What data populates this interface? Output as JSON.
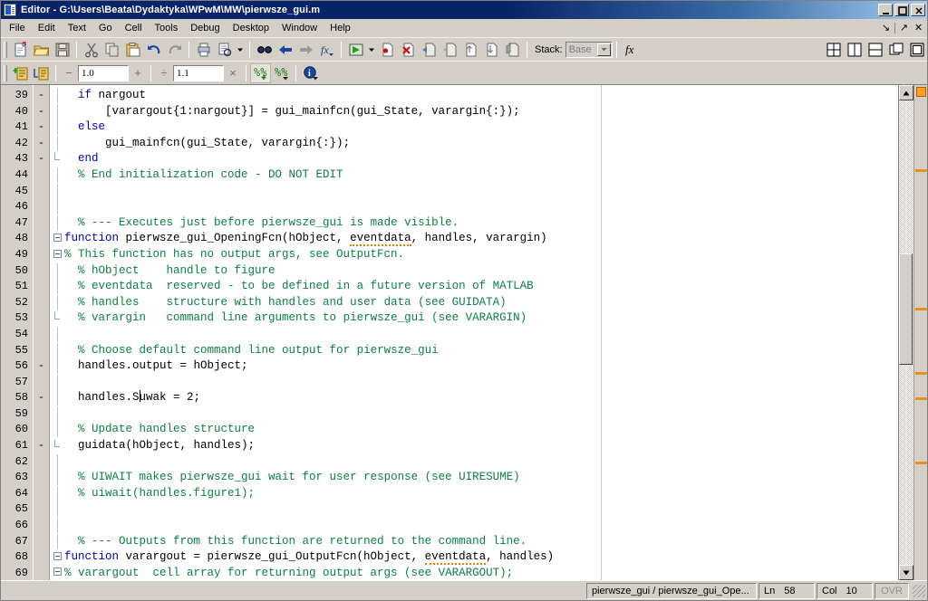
{
  "window": {
    "title": "Editor - G:\\Users\\Beata\\Dydaktyka\\WPwM\\MW\\pierwsze_gui.m",
    "icon": "editor-document-icon",
    "minimize_label": "_",
    "maximize_label": "☐",
    "close_label": "✕"
  },
  "menubar": {
    "items": [
      {
        "label": "File"
      },
      {
        "label": "Edit"
      },
      {
        "label": "Text"
      },
      {
        "label": "Go"
      },
      {
        "label": "Cell"
      },
      {
        "label": "Tools"
      },
      {
        "label": "Debug"
      },
      {
        "label": "Desktop"
      },
      {
        "label": "Window"
      },
      {
        "label": "Help"
      }
    ],
    "dock_label": "↘",
    "undock_label": "↗",
    "close_label": "✕"
  },
  "toolbar_main": {
    "buttons": [
      {
        "name": "new-file-icon",
        "title": "New"
      },
      {
        "name": "open-file-icon",
        "title": "Open"
      },
      {
        "name": "save-icon",
        "title": "Save"
      },
      {
        "name": "cut-icon",
        "title": "Cut"
      },
      {
        "name": "copy-icon",
        "title": "Copy"
      },
      {
        "name": "paste-icon",
        "title": "Paste"
      },
      {
        "name": "undo-icon",
        "title": "Undo"
      },
      {
        "name": "redo-icon",
        "title": "Redo"
      },
      {
        "name": "print-icon",
        "title": "Print"
      },
      {
        "name": "print-preview-icon",
        "title": "Print Preview"
      },
      {
        "name": "find-icon",
        "title": "Find"
      },
      {
        "name": "back-arrow-icon",
        "title": "Back"
      },
      {
        "name": "forward-arrow-icon",
        "title": "Forward"
      },
      {
        "name": "function-browser-icon",
        "title": "Function Browser"
      },
      {
        "name": "run-icon",
        "title": "Run"
      },
      {
        "name": "set-breakpoint-icon",
        "title": "Set/Clear Breakpoint"
      },
      {
        "name": "clear-breakpoints-icon",
        "title": "Clear All Breakpoints"
      },
      {
        "name": "step-icon",
        "title": "Step"
      },
      {
        "name": "step-in-icon",
        "title": "Step In"
      },
      {
        "name": "step-out-icon",
        "title": "Step Out"
      },
      {
        "name": "continue-icon",
        "title": "Continue"
      },
      {
        "name": "exit-debug-icon",
        "title": "Exit Debug Mode"
      }
    ],
    "stack_label": "Stack:",
    "stack_value": "Base",
    "fx_label": "fx",
    "layout_buttons": [
      {
        "name": "tile-four-icon"
      },
      {
        "name": "tile-vertical-icon"
      },
      {
        "name": "tile-horizontal-icon"
      },
      {
        "name": "cascade-icon"
      },
      {
        "name": "single-pane-icon"
      }
    ]
  },
  "toolbar_cell": {
    "buttons": [
      {
        "name": "insert-cell-icon",
        "title": "Insert Cell Divider"
      },
      {
        "name": "insert-cell-markup-icon",
        "title": "Insert Cell Markup"
      },
      {
        "name": "evaluate-cell-plus-icon",
        "title": "Evaluate Cell and Advance"
      },
      {
        "name": "evaluate-cell-icon",
        "title": "Evaluate Cell"
      },
      {
        "name": "cell-help-icon",
        "title": "Cell Mode Help"
      }
    ],
    "decrement_label": "−",
    "increment_label": "+",
    "divide_label": "÷",
    "multiply_label": "×",
    "value_add": "1.0",
    "value_multiply": "1.1"
  },
  "editor": {
    "caret_line": 58,
    "caret_col": 10,
    "lines": [
      {
        "num": 39,
        "mark": "-",
        "fold": "",
        "indent": 1,
        "tokens": [
          {
            "t": "kw",
            "v": "if"
          },
          {
            "t": "p",
            "v": " nargout"
          }
        ]
      },
      {
        "num": 40,
        "mark": "-",
        "fold": "",
        "indent": 1,
        "tokens": [
          {
            "t": "p",
            "v": "    [varargout{1:nargout}] = gui_mainfcn(gui_State, varargin{:});"
          }
        ]
      },
      {
        "num": 41,
        "mark": "-",
        "fold": "",
        "indent": 1,
        "tokens": [
          {
            "t": "kw",
            "v": "else"
          }
        ]
      },
      {
        "num": 42,
        "mark": "-",
        "fold": "",
        "indent": 1,
        "tokens": [
          {
            "t": "p",
            "v": "    gui_mainfcn(gui_State, varargin{:});"
          }
        ]
      },
      {
        "num": 43,
        "mark": "-",
        "fold": "end",
        "indent": 1,
        "tokens": [
          {
            "t": "kw",
            "v": "end"
          }
        ]
      },
      {
        "num": 44,
        "mark": "",
        "fold": "",
        "indent": 1,
        "tokens": [
          {
            "t": "cm",
            "v": "% End initialization code - DO NOT EDIT"
          }
        ]
      },
      {
        "num": 45,
        "mark": "",
        "fold": "",
        "indent": 1,
        "tokens": []
      },
      {
        "num": 46,
        "mark": "",
        "fold": "",
        "indent": 1,
        "tokens": []
      },
      {
        "num": 47,
        "mark": "",
        "fold": "",
        "indent": 1,
        "tokens": [
          {
            "t": "cm",
            "v": "% --- Executes just before pierwsze_gui is made visible."
          }
        ]
      },
      {
        "num": 48,
        "mark": "",
        "fold": "box",
        "indent": 0,
        "tokens": [
          {
            "t": "kw",
            "v": "function"
          },
          {
            "t": "p",
            "v": " pierwsze_gui_OpeningFcn(hObject, "
          },
          {
            "t": "sq",
            "v": "eventdata"
          },
          {
            "t": "p",
            "v": ", handles, varargin)"
          }
        ]
      },
      {
        "num": 49,
        "mark": "",
        "fold": "box",
        "indent": 0,
        "tokens": [
          {
            "t": "cm",
            "v": "% This function has no output args, see OutputFcn."
          }
        ]
      },
      {
        "num": 50,
        "mark": "",
        "fold": "",
        "indent": 1,
        "tokens": [
          {
            "t": "cm",
            "v": "% hObject    handle to figure"
          }
        ]
      },
      {
        "num": 51,
        "mark": "",
        "fold": "",
        "indent": 1,
        "tokens": [
          {
            "t": "cm",
            "v": "% eventdata  reserved - to be defined in a future version of MATLAB"
          }
        ]
      },
      {
        "num": 52,
        "mark": "",
        "fold": "",
        "indent": 1,
        "tokens": [
          {
            "t": "cm",
            "v": "% handles    structure with handles and user data (see GUIDATA)"
          }
        ]
      },
      {
        "num": 53,
        "mark": "",
        "fold": "end",
        "indent": 1,
        "tokens": [
          {
            "t": "cm",
            "v": "% varargin   command line arguments to pierwsze_gui (see VARARGIN)"
          }
        ]
      },
      {
        "num": 54,
        "mark": "",
        "fold": "",
        "indent": 1,
        "tokens": []
      },
      {
        "num": 55,
        "mark": "",
        "fold": "",
        "indent": 1,
        "tokens": [
          {
            "t": "cm",
            "v": "% Choose default command line output for pierwsze_gui"
          }
        ]
      },
      {
        "num": 56,
        "mark": "-",
        "fold": "",
        "indent": 1,
        "tokens": [
          {
            "t": "p",
            "v": "handles.output = hObject;"
          }
        ]
      },
      {
        "num": 57,
        "mark": "",
        "fold": "",
        "indent": 1,
        "tokens": []
      },
      {
        "num": 58,
        "mark": "-",
        "fold": "",
        "indent": 1,
        "tokens": [
          {
            "t": "p",
            "v": "handles.S"
          },
          {
            "t": "caret",
            "v": ""
          },
          {
            "t": "p",
            "v": "uwak = 2;"
          }
        ]
      },
      {
        "num": 59,
        "mark": "",
        "fold": "",
        "indent": 1,
        "tokens": []
      },
      {
        "num": 60,
        "mark": "",
        "fold": "",
        "indent": 1,
        "tokens": [
          {
            "t": "cm",
            "v": "% Update handles structure"
          }
        ]
      },
      {
        "num": 61,
        "mark": "-",
        "fold": "end",
        "indent": 1,
        "tokens": [
          {
            "t": "p",
            "v": "guidata(hObject, handles);"
          }
        ]
      },
      {
        "num": 62,
        "mark": "",
        "fold": "",
        "indent": 1,
        "tokens": []
      },
      {
        "num": 63,
        "mark": "",
        "fold": "",
        "indent": 1,
        "tokens": [
          {
            "t": "cm",
            "v": "% UIWAIT makes pierwsze_gui wait for user response (see UIRESUME)"
          }
        ]
      },
      {
        "num": 64,
        "mark": "",
        "fold": "",
        "indent": 1,
        "tokens": [
          {
            "t": "cm",
            "v": "% uiwait(handles.figure1);"
          }
        ]
      },
      {
        "num": 65,
        "mark": "",
        "fold": "",
        "indent": 1,
        "tokens": []
      },
      {
        "num": 66,
        "mark": "",
        "fold": "",
        "indent": 1,
        "tokens": []
      },
      {
        "num": 67,
        "mark": "",
        "fold": "",
        "indent": 1,
        "tokens": [
          {
            "t": "cm",
            "v": "% --- Outputs from this function are returned to the command line."
          }
        ]
      },
      {
        "num": 68,
        "mark": "",
        "fold": "box",
        "indent": 0,
        "tokens": [
          {
            "t": "kw",
            "v": "function"
          },
          {
            "t": "p",
            "v": " varargout = pierwsze_gui_OutputFcn(hObject, "
          },
          {
            "t": "sq",
            "v": "eventdata"
          },
          {
            "t": "p",
            "v": ", handles)"
          }
        ]
      },
      {
        "num": 69,
        "mark": "",
        "fold": "box",
        "indent": 0,
        "tokens": [
          {
            "t": "cm",
            "v": "% varargout  cell array for returning output args (see VARARGOUT);"
          }
        ]
      }
    ]
  },
  "scrollbar": {
    "up_label": "▲",
    "down_label": "▼",
    "thumb_top_pct": 33,
    "thumb_height_pct": 24
  },
  "mlint": {
    "top_marker_color": "#ffa020",
    "marks_pct": [
      17,
      45,
      58,
      63,
      76
    ]
  },
  "statusbar": {
    "function_path": "pierwsze_gui / pierwsze_gui_Ope...",
    "line_label": "Ln",
    "line_value": "58",
    "col_label": "Col",
    "col_value": "10",
    "overwrite_label": "OVR"
  },
  "colors": {
    "titlebar": "#0a246a",
    "chrome": "#d4d0c8",
    "keyword": "#0000c0",
    "comment": "#0b8040",
    "warning": "#e89020"
  }
}
